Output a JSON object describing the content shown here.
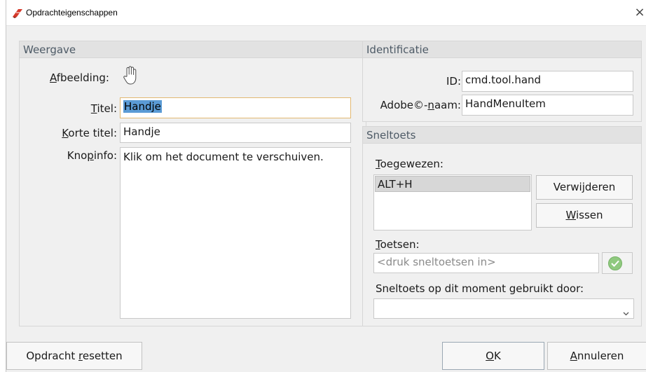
{
  "window": {
    "title": "Opdrachteigenschappen",
    "close_glyph": "×",
    "app_icon": "pdf-app-icon"
  },
  "appearance": {
    "header": "Weergave",
    "image_label_u": "A",
    "image_label_rest": "fbeelding:",
    "image_icon": "hand-icon",
    "title_label_u": "T",
    "title_label_rest": "itel:",
    "title_value": "Handje",
    "short_title_label_u": "K",
    "short_title_label_rest": "orte titel:",
    "short_title_value": "Handje",
    "tooltip_label_pre": "Kno",
    "tooltip_label_u": "p",
    "tooltip_label_rest": "info:",
    "tooltip_value": "Klik om het document te verschuiven."
  },
  "identification": {
    "header": "Identificatie",
    "id_label": "ID:",
    "id_value": "cmd.tool.hand",
    "adobe_label_pre": "Adobe©-",
    "adobe_label_u": "n",
    "adobe_label_rest": "aam:",
    "adobe_value": "HandMenuItem"
  },
  "shortcut": {
    "header": "Sneltoets",
    "assigned_label_u": "T",
    "assigned_label_rest": "oegewezen:",
    "assigned_items": [
      "ALT+H"
    ],
    "remove_button": "Verwijderen",
    "clear_button_u": "W",
    "clear_button_rest": "issen",
    "keys_label_u": "T",
    "keys_label_rest": "oetsen:",
    "keys_placeholder": "<druk sneltoetsen in>",
    "used_by_label": "Sneltoets op dit moment gebruikt door:",
    "used_by_value": ""
  },
  "footer": {
    "reset_pre": "Opdracht ",
    "reset_u": "r",
    "reset_rest": "esetten",
    "ok_u": "O",
    "ok_rest": "K",
    "cancel_u": "A",
    "cancel_rest": "nnuleren"
  },
  "colors": {
    "group_header_bg": "#e2e2e2",
    "group_header_text": "#4d5a66",
    "selection": "#5b9bd5",
    "confirm_green": "#8fc97f"
  }
}
